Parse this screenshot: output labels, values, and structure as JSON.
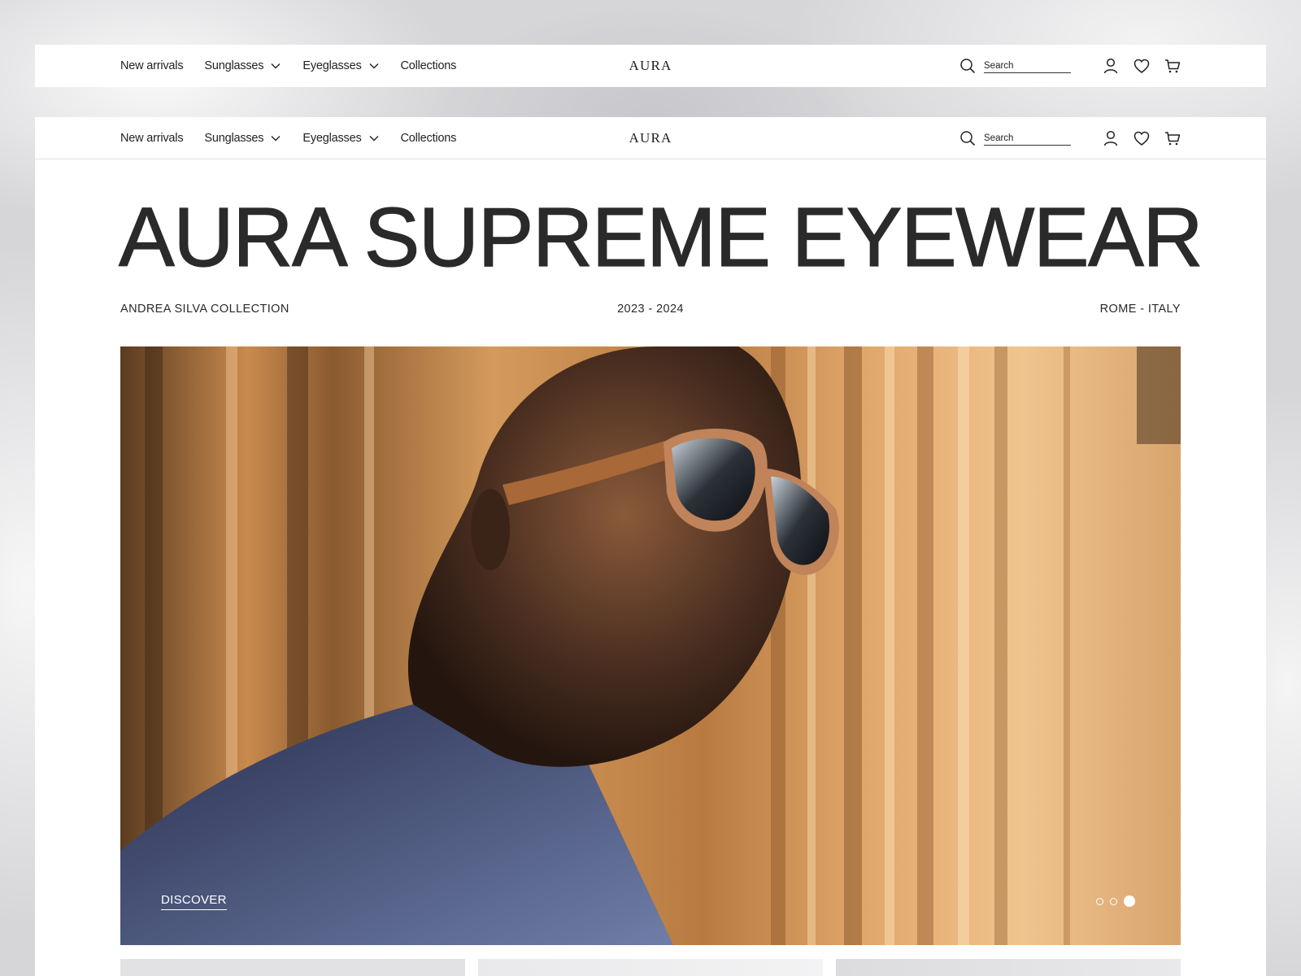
{
  "nav": {
    "links": [
      {
        "label": "New arrivals"
      },
      {
        "label": "Sunglasses"
      },
      {
        "label": "Eyeglasses"
      },
      {
        "label": "Collections"
      }
    ],
    "brand": "AURA",
    "search_placeholder": "Search"
  },
  "hero": {
    "title": "AURA SUPREME EYEWEAR",
    "collection": "ANDREA SILVA COLLECTION",
    "years": "2023 - 2024",
    "location": "ROME - ITALY",
    "cta_label": "DISCOVER",
    "slides": {
      "total": 3,
      "active": 3
    }
  },
  "icons": {
    "search": "search-icon",
    "account": "user-icon",
    "wishlist": "heart-icon",
    "cart": "cart-icon",
    "dropdown": "chevron-down-icon"
  }
}
